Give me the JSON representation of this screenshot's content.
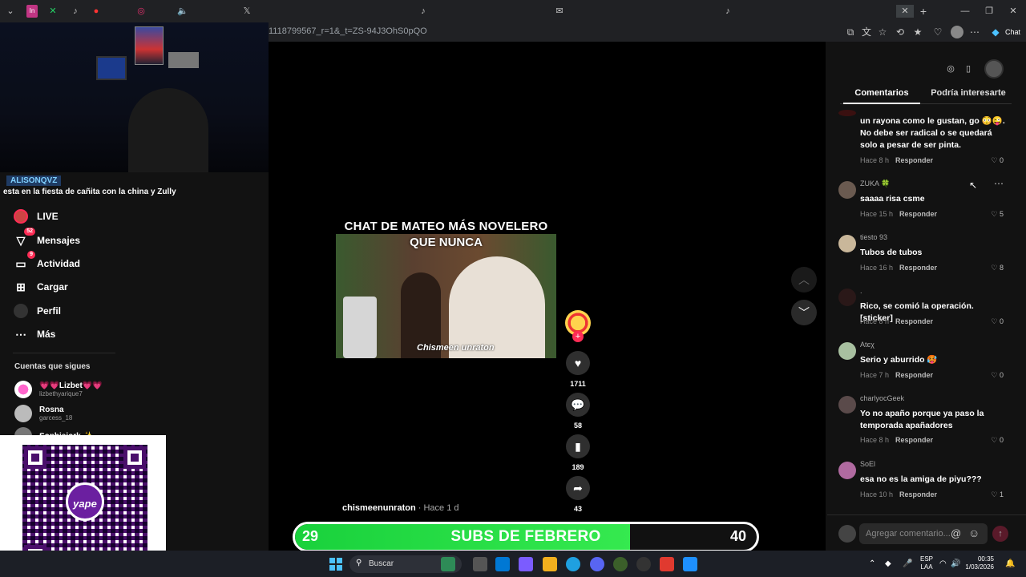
{
  "browser": {
    "url": "1118799567_r=1&_t=ZS-94J3OhS0pQO",
    "chat_label": "Chat"
  },
  "stream_overlay": {
    "user_tag": "ALISONQVZ",
    "message": "esta en la fiesta de cañita con la china y Zully"
  },
  "sidebar": {
    "nav": [
      {
        "label": "LIVE",
        "icon": "live-icon",
        "badge": ""
      },
      {
        "label": "Mensajes",
        "icon": "messages-icon",
        "badge": "52"
      },
      {
        "label": "Actividad",
        "icon": "activity-icon",
        "badge": "9"
      },
      {
        "label": "Cargar",
        "icon": "upload-icon",
        "badge": ""
      },
      {
        "label": "Perfil",
        "icon": "profile-icon",
        "badge": ""
      },
      {
        "label": "Más",
        "icon": "more-icon",
        "badge": ""
      }
    ],
    "following_title": "Cuentas que sigues",
    "following": [
      {
        "name": "💗💗Lizbet💗💗",
        "handle": "lizbethyarique7"
      },
      {
        "name": "Rosna",
        "handle": "garcess_18"
      },
      {
        "name": "Sophiejork ✨",
        "handle": ""
      }
    ]
  },
  "qr": {
    "logo_text": "yape"
  },
  "video": {
    "title_line1": "CHAT DE MATEO MÁS NOVELERO",
    "title_line2": "QUE NUNCA",
    "watermark": "Chismeen unraton",
    "author": "chismeenunraton",
    "posted": " · Hace 1 d",
    "likes": "1711",
    "comments": "58",
    "saves": "189",
    "shares": "43"
  },
  "subs_bar": {
    "current": "29",
    "goal": "40",
    "label": "SUBS DE FEBRERO",
    "fill_fraction": 0.725,
    "fill_color": "#19d13c"
  },
  "right_panel": {
    "tab_comments": "Comentarios",
    "tab_suggest": "Podría interesarte",
    "comments": [
      {
        "user": "",
        "text": "un rayona como le gustan, go 😳😜. No debe ser radical o se quedará solo a pesar de ser pinta.",
        "time": "Hace 8 h",
        "reply": "Responder",
        "likes": "0"
      },
      {
        "user": "ZUKA 🍀",
        "text": "saaaa risa csme",
        "time": "Hace 15 h",
        "reply": "Responder",
        "likes": "5"
      },
      {
        "user": "tiesto 93",
        "text": "Tubos de tubos",
        "time": "Hace 16 h",
        "reply": "Responder",
        "likes": "8"
      },
      {
        "user": ".",
        "text": "Rico, se comió la operación. [sticker]",
        "time": "Hace 8 h",
        "reply": "Responder",
        "likes": "0"
      },
      {
        "user": "Atєχ",
        "text": "Serio y aburrido 🥵",
        "time": "Hace 7 h",
        "reply": "Responder",
        "likes": "0"
      },
      {
        "user": "charlyocGeek",
        "text": "Yo no apaño porque ya paso la temporada apañadores",
        "time": "Hace 8 h",
        "reply": "Responder",
        "likes": "0"
      },
      {
        "user": "SoEl",
        "text": "esa no es la amiga de piyu???",
        "time": "Hace 10 h",
        "reply": "Responder",
        "likes": "1"
      }
    ],
    "input_placeholder": "Agregar comentario..."
  },
  "taskbar": {
    "search_label": "Buscar",
    "lang_line1": "ESP",
    "lang_line2": "LAA",
    "time": "00:35",
    "date": "1/03/2026"
  }
}
